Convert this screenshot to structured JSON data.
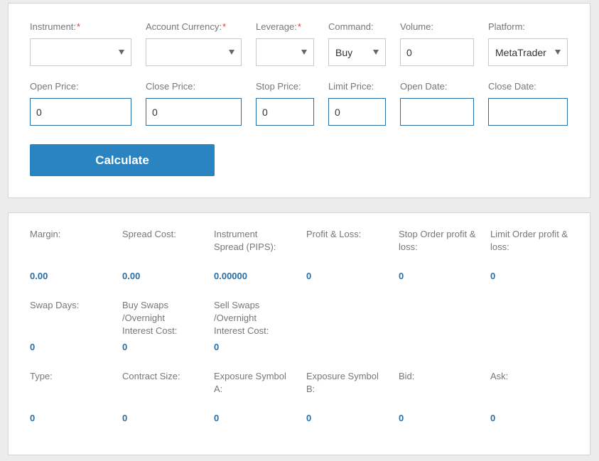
{
  "form": {
    "instrument": {
      "label": "Instrument:",
      "required_mark": "*",
      "value": ""
    },
    "account_currency": {
      "label": "Account Currency:",
      "required_mark": "*",
      "value": ""
    },
    "leverage": {
      "label": "Leverage:",
      "required_mark": "*",
      "value": ""
    },
    "command": {
      "label": "Command:",
      "value": "Buy"
    },
    "volume": {
      "label": "Volume:",
      "value": "0"
    },
    "platform": {
      "label": "Platform:",
      "value": "MetaTrader"
    },
    "open_price": {
      "label": "Open Price:",
      "value": "0"
    },
    "close_price": {
      "label": "Close Price:",
      "value": "0"
    },
    "stop_price": {
      "label": "Stop Price:",
      "value": "0"
    },
    "limit_price": {
      "label": "Limit Price:",
      "value": "0"
    },
    "open_date": {
      "label": "Open Date:",
      "value": ""
    },
    "close_date": {
      "label": "Close Date:",
      "value": ""
    },
    "calculate_label": "Calculate"
  },
  "results": {
    "margin": {
      "label": "Margin:",
      "value": "0.00"
    },
    "spread_cost": {
      "label": "Spread Cost:",
      "value": "0.00"
    },
    "instrument_spread": {
      "label": "Instrument Spread (PIPS):",
      "value": "0.00000"
    },
    "profit_loss": {
      "label": "Profit & Loss:",
      "value": "0"
    },
    "stop_order_pl": {
      "label": "Stop Order profit & loss:",
      "value": "0"
    },
    "limit_order_pl": {
      "label": "Limit Order profit & loss:",
      "value": "0"
    },
    "swap_days": {
      "label": "Swap Days:",
      "value": "0"
    },
    "buy_swaps": {
      "label": "Buy Swaps /Overnight Interest Cost:",
      "value": "0"
    },
    "sell_swaps": {
      "label": "Sell Swaps /Overnight Interest Cost:",
      "value": "0"
    },
    "type": {
      "label": "Type:",
      "value": "0"
    },
    "contract_size": {
      "label": "Contract Size:",
      "value": "0"
    },
    "exposure_a": {
      "label": "Exposure Symbol A:",
      "value": "0"
    },
    "exposure_b": {
      "label": "Exposure Symbol B:",
      "value": "0"
    },
    "bid": {
      "label": "Bid:",
      "value": "0"
    },
    "ask": {
      "label": "Ask:",
      "value": "0"
    }
  },
  "colors": {
    "accent": "#2a84c2",
    "value_text": "#2a6ea4",
    "required": "#e23c3c"
  },
  "icons": {
    "select_caret": "chevron-down-icon"
  }
}
